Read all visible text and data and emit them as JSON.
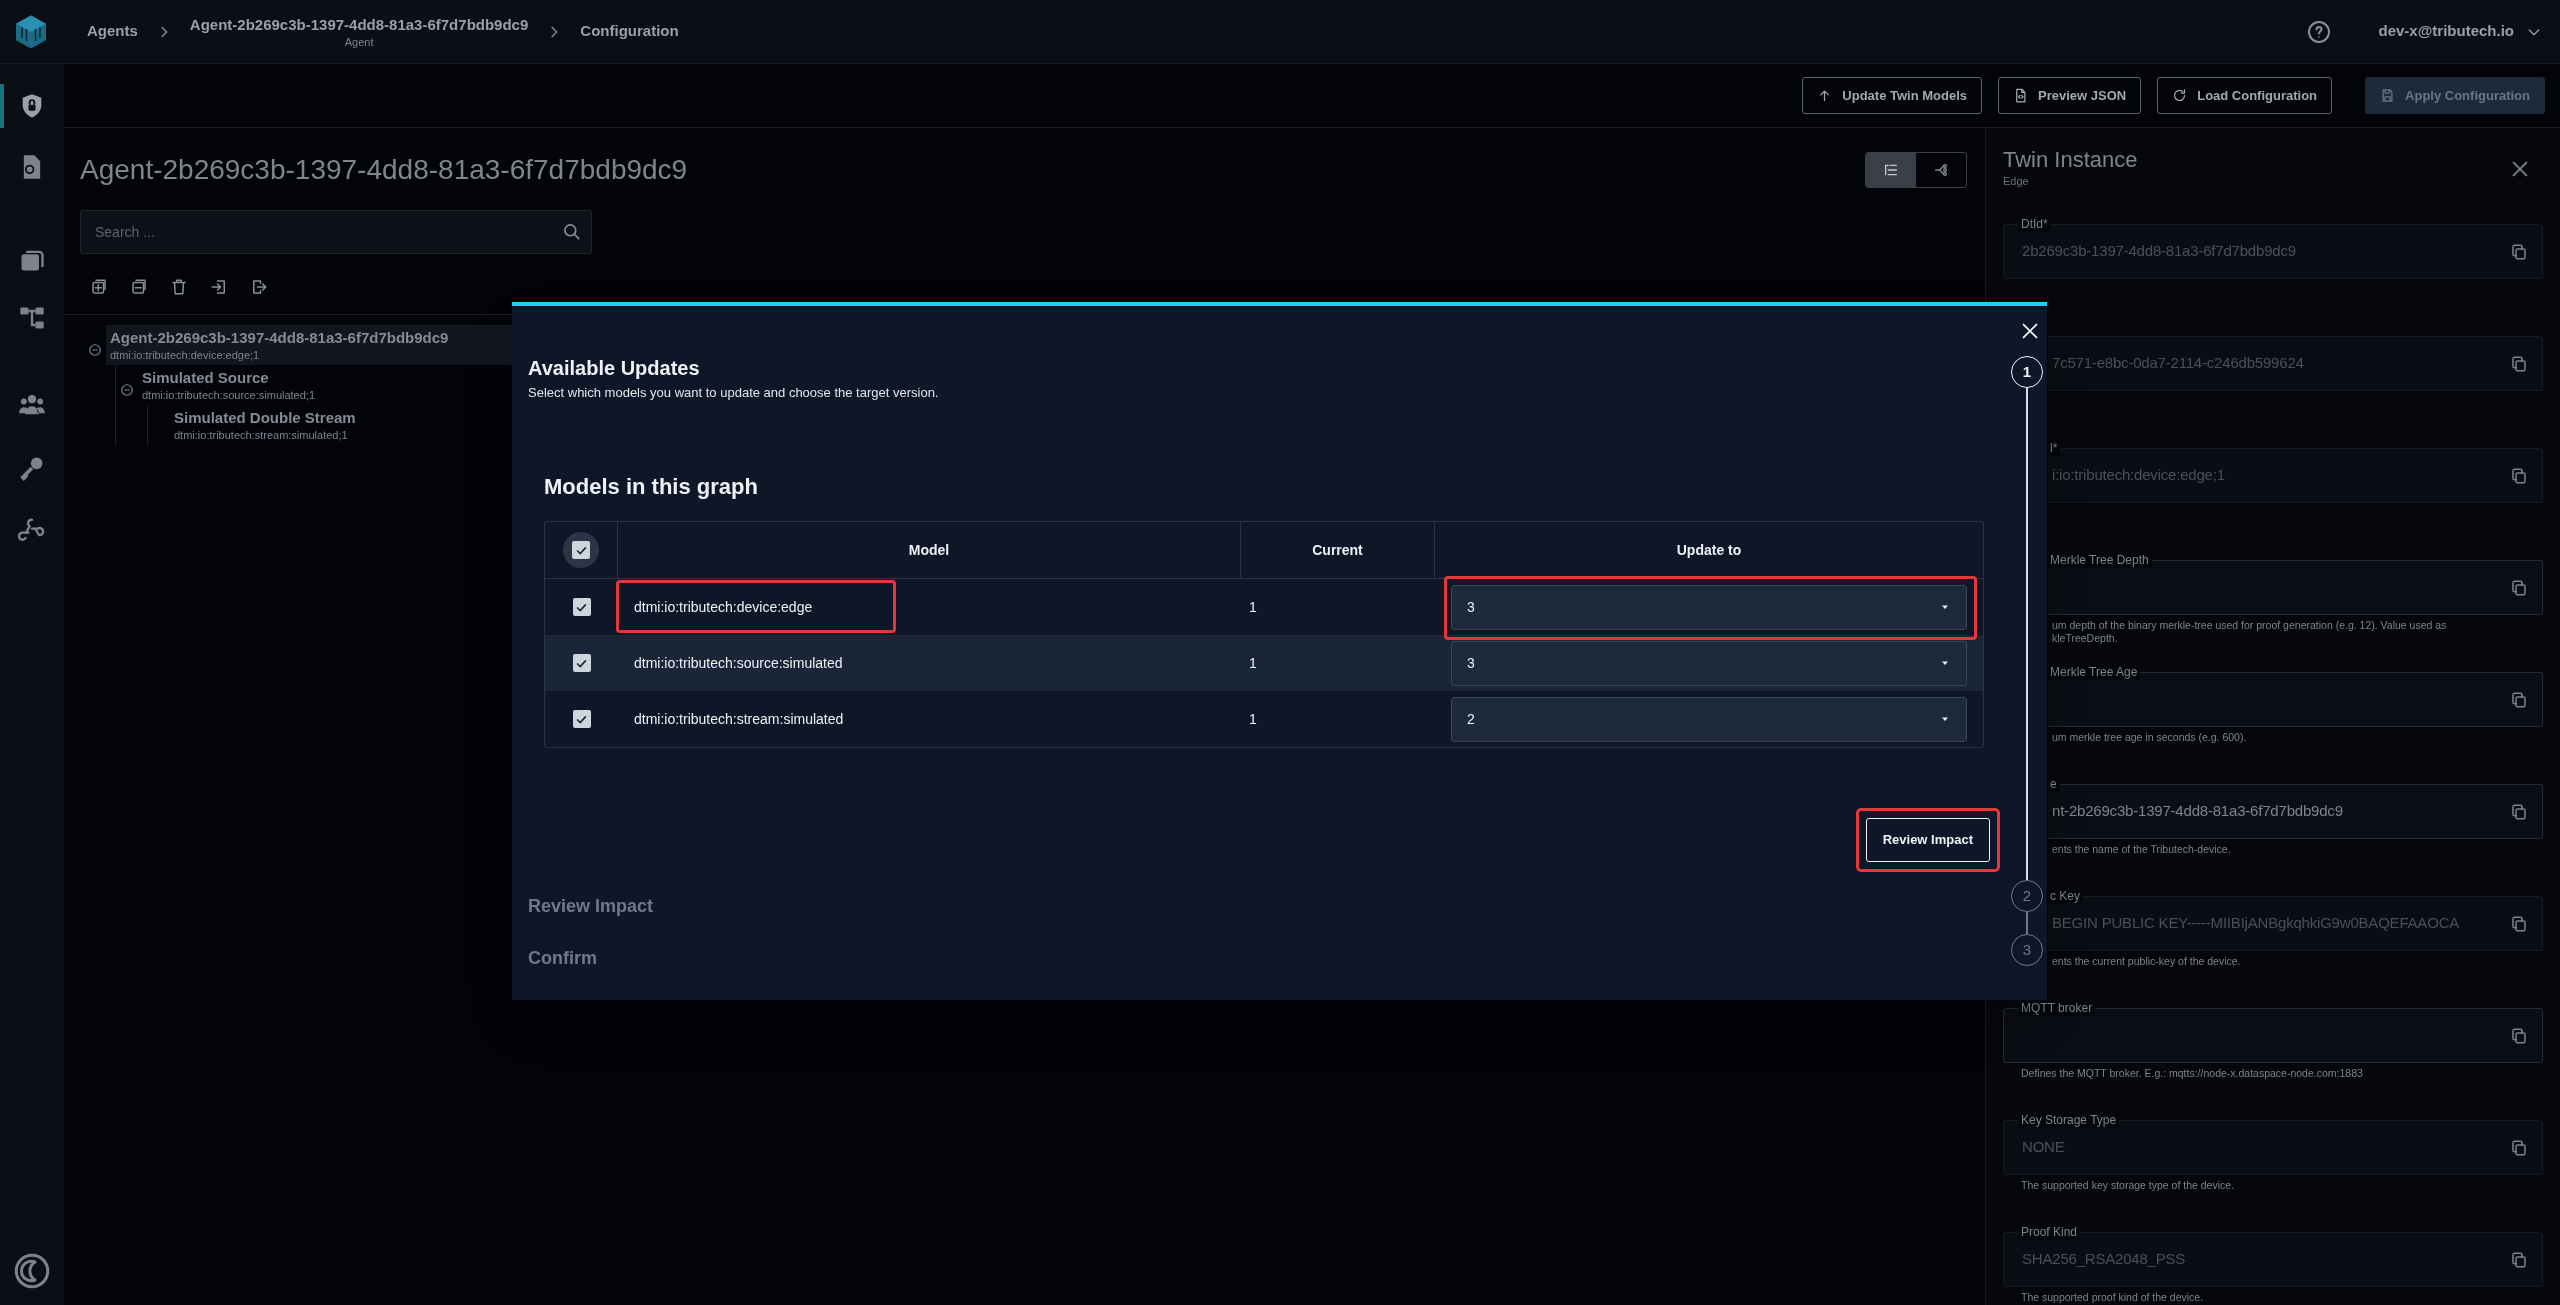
{
  "header": {
    "breadcrumbs": [
      {
        "label": "Agents"
      },
      {
        "label": "Agent-2b269c3b-1397-4dd8-81a3-6f7d7bdb9dc9",
        "sublabel": "Agent"
      },
      {
        "label": "Configuration"
      }
    ],
    "user": "dev-x@tributech.io"
  },
  "nav_rail": {
    "items": [
      {
        "kind": "shield",
        "selected": true
      },
      {
        "kind": "certificate",
        "selected": false
      },
      {
        "kind": "cards",
        "selected": false
      },
      {
        "kind": "hierarchy",
        "selected": false
      },
      {
        "kind": "people",
        "selected": false
      },
      {
        "kind": "key",
        "selected": false
      },
      {
        "kind": "webhook",
        "selected": false
      }
    ]
  },
  "toolbar": {
    "buttons": [
      {
        "kind": "upload",
        "label": "Update Twin Models",
        "disabled": false
      },
      {
        "kind": "file",
        "label": "Preview JSON",
        "disabled": false
      },
      {
        "kind": "reload",
        "label": "Load Configuration",
        "disabled": false
      },
      {
        "kind": "save",
        "label": "Apply Configuration",
        "disabled": true
      }
    ]
  },
  "main": {
    "title": "Agent-2b269c3b-1397-4dd8-81a3-6f7d7bdb9dc9",
    "view_toggle": [
      {
        "kind": "list",
        "selected": true
      },
      {
        "kind": "graph",
        "selected": false
      }
    ],
    "search": {
      "placeholder": "Search ..."
    },
    "tree_actions": [
      {
        "kind": "expand"
      },
      {
        "kind": "collapse"
      },
      {
        "kind": "delete"
      },
      {
        "kind": "import"
      },
      {
        "kind": "export"
      }
    ],
    "tree": [
      {
        "name": "Agent-2b269c3b-1397-4dd8-81a3-6f7d7bdb9dc9",
        "model": "dtmi:io:tributech:device:edge;1",
        "selected": true,
        "expanded": true,
        "children": [
          {
            "name": "Simulated Source",
            "model": "dtmi:io:tributech:source:simulated;1",
            "selected": false,
            "expanded": true,
            "children": [
              {
                "name": "Simulated Double Stream",
                "model": "dtmi:io:tributech:stream:simulated;1",
                "selected": false
              }
            ]
          }
        ]
      }
    ]
  },
  "details_panel": {
    "title": "Twin Instance",
    "subtitle": "Edge",
    "fields": [
      {
        "label": "DtId*",
        "value": "2b269c3b-1397-4dd8-81a3-6f7d7bdb9dc9",
        "disabled": true,
        "obscured": false
      },
      {
        "value": "7c571-e8bc-0da7-2114-c246db599624",
        "disabled": true,
        "obscured": true
      },
      {
        "label": "l*",
        "value": "i:io:tributech:device:edge;1",
        "disabled": true,
        "obscured": true
      },
      {
        "label": "Merkle Tree Depth",
        "helper": "um depth of the binary merkle-tree used for proof generation (e.g. 12). Value used as kleTreeDepth.",
        "disabled": false,
        "obscured": true
      },
      {
        "label": "Merkle Tree Age",
        "helper": "um merkle tree age in seconds (e.g. 600).",
        "disabled": false,
        "obscured": true
      },
      {
        "label": "e",
        "value": "nt-2b269c3b-1397-4dd8-81a3-6f7d7bdb9dc9",
        "helper": "ents the name of the Tributech-device.",
        "disabled": false,
        "obscured": true
      },
      {
        "label": "c Key",
        "value": "BEGIN PUBLIC KEY-----MIIBIjANBgkqhkiG9w0BAQEFAAOCA",
        "helper": "ents the current public-key of the device.",
        "disabled": true,
        "obscured": true
      },
      {
        "label": "MQTT broker",
        "helper": "Defines the MQTT broker. E.g.: mqtts://node-x.dataspace-node.com:1883",
        "disabled": false,
        "obscured": false
      },
      {
        "label": "Key Storage Type",
        "value": "NONE",
        "helper": "The supported key storage type of the device.",
        "disabled": true,
        "obscured": false
      },
      {
        "label": "Proof Kind",
        "value": "SHA256_RSA2048_PSS",
        "helper": "The supported proof kind of the device.",
        "disabled": true,
        "obscured": false
      }
    ]
  },
  "dialog": {
    "steps": [
      {
        "number": "1",
        "title": "Available Updates",
        "subtitle": "Select which models you want to update and choose the target version.",
        "active": true
      },
      {
        "number": "2",
        "title": "Review Impact",
        "active": false
      },
      {
        "number": "3",
        "title": "Confirm",
        "active": false
      }
    ],
    "section_title": "Models in this graph",
    "table": {
      "all_checked": true,
      "columns": [
        "Model",
        "Current",
        "Update to"
      ],
      "rows": [
        {
          "checked": true,
          "hovered": false,
          "highlighted": true,
          "model": "dtmi:io:tributech:device:edge",
          "current": "1",
          "update_to": "3"
        },
        {
          "checked": true,
          "hovered": true,
          "highlighted": false,
          "model": "dtmi:io:tributech:source:simulated",
          "current": "1",
          "update_to": "3"
        },
        {
          "checked": true,
          "hovered": false,
          "highlighted": false,
          "model": "dtmi:io:tributech:stream:simulated",
          "current": "1",
          "update_to": "2"
        }
      ]
    },
    "next_button": {
      "label": "Review Impact",
      "highlighted": true
    }
  }
}
